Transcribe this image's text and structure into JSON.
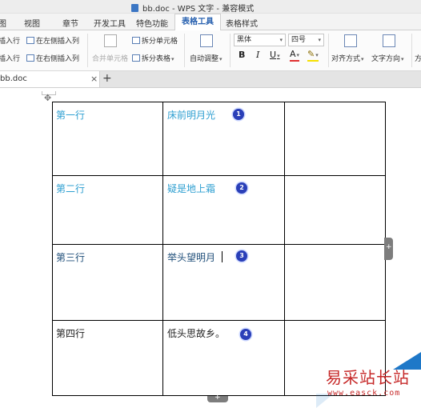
{
  "window": {
    "title": "bb.doc - WPS 文字 - 兼容模式"
  },
  "menu_tabs": [
    "图",
    "视图",
    "章节",
    "开发工具",
    "特色功能",
    "表格工具",
    "表格样式"
  ],
  "active_tab": "表格工具",
  "ribbon": {
    "insert_above": "插入行",
    "insert_below": "插入行",
    "insert_left": "在左侧插入列",
    "insert_right": "在右侧插入列",
    "merge_cells": "合并单元格",
    "split_cells": "拆分单元格",
    "split_table": "拆分表格",
    "auto_adjust": "自动调整",
    "font_name": "黑体",
    "font_size": "四号",
    "bold": "B",
    "italic": "I",
    "underline": "U",
    "font_color": "A",
    "align": "对齐方式",
    "text_direction": "文字方向",
    "partial_label": "方"
  },
  "document_tab": {
    "name": "bb.doc",
    "close": "×",
    "new_tab": "+"
  },
  "table": {
    "rows": [
      {
        "label": "第一行",
        "text": "床前明月光",
        "badge": "1"
      },
      {
        "label": "第二行",
        "text": "疑是地上霜",
        "badge": "2"
      },
      {
        "label": "第三行",
        "text": "举头望明月",
        "badge": "3"
      },
      {
        "label": "第四行",
        "text": "低头思故乡。",
        "badge": "4"
      }
    ]
  },
  "handles": {
    "side": "+",
    "bottom": "+"
  },
  "watermark": {
    "title": "易采站长站",
    "url": "www.easck.com"
  },
  "colors": {
    "active_tab": "#2a62b0",
    "text_dark": "#1f4e79",
    "text_light": "#2e9fd1",
    "badge": "#2a3fb8",
    "watermark_red": "#c62828",
    "watermark_blue": "#1e78c8"
  }
}
